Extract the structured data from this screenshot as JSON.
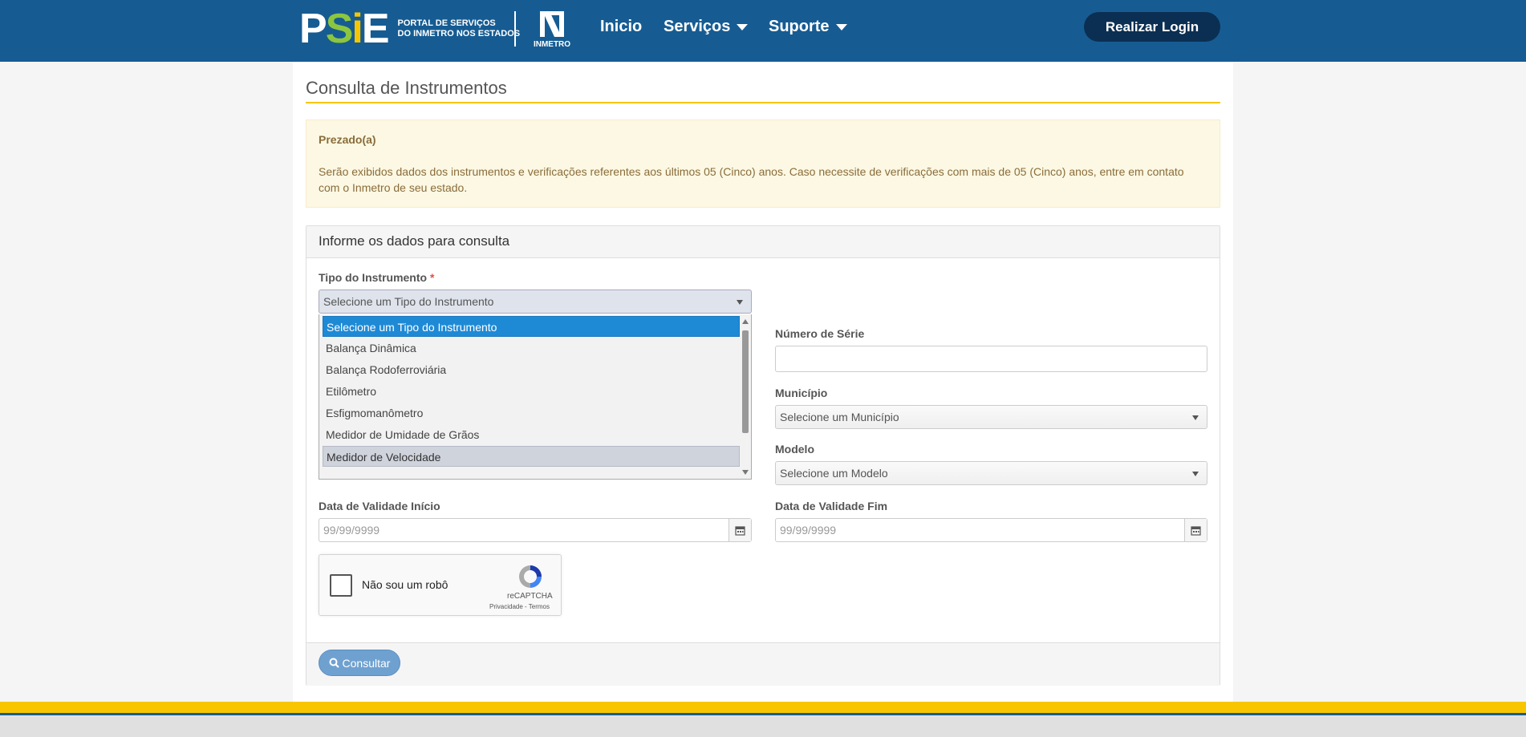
{
  "header": {
    "logo_text_p": "P",
    "logo_text_s": "S",
    "logo_text_i": "i",
    "logo_text_e": "E",
    "logo_sub_line1": "PORTAL DE SERVIÇOS",
    "logo_sub_line2": "DO INMETRO NOS ESTADOS",
    "inmetro_label": "INMETRO",
    "nav": [
      {
        "label": "Inicio"
      },
      {
        "label": "Serviços"
      },
      {
        "label": "Suporte"
      }
    ],
    "login_label": "Realizar Login"
  },
  "page": {
    "title": "Consulta de Instrumentos"
  },
  "alert": {
    "heading": "Prezado(a)",
    "body": "Serão exibidos dados dos instrumentos e verificações referentes aos últimos 05 (Cinco) anos. Caso necessite de verificações com mais de 05 (Cinco) anos, entre em contato com o Inmetro de seu estado."
  },
  "form": {
    "panel_title": "Informe os dados para consulta",
    "tipo_label": "Tipo do Instrumento",
    "required_mark": "*",
    "tipo_value": "Selecione um Tipo do Instrumento",
    "tipo_options": [
      "Selecione um Tipo do Instrumento",
      "Balança Dinâmica",
      "Balança Rodoferroviária",
      "Etilômetro",
      "Esfigmomanômetro",
      "Medidor de Umidade de Grãos",
      "Medidor de Velocidade"
    ],
    "numero_serie_label": "Número de Série",
    "numero_serie_value": "",
    "municipio_label": "Município",
    "municipio_value": "Selecione um Município",
    "modelo_label": "Modelo",
    "modelo_value": "Selecione um Modelo",
    "data_inicio_label": "Data de Validade Início",
    "data_inicio_placeholder": "99/99/9999",
    "data_fim_label": "Data de Validade Fim",
    "data_fim_placeholder": "99/99/9999",
    "captcha_label": "Não sou um robô",
    "captcha_brand": "reCAPTCHA",
    "captcha_links": "Privacidade - Termos",
    "submit_label": "Consultar"
  },
  "colors": {
    "navbar": "#165c93",
    "accent_yellow": "#f7c600",
    "selected_option": "#1e8ad6",
    "button": "#6fa1d0"
  }
}
